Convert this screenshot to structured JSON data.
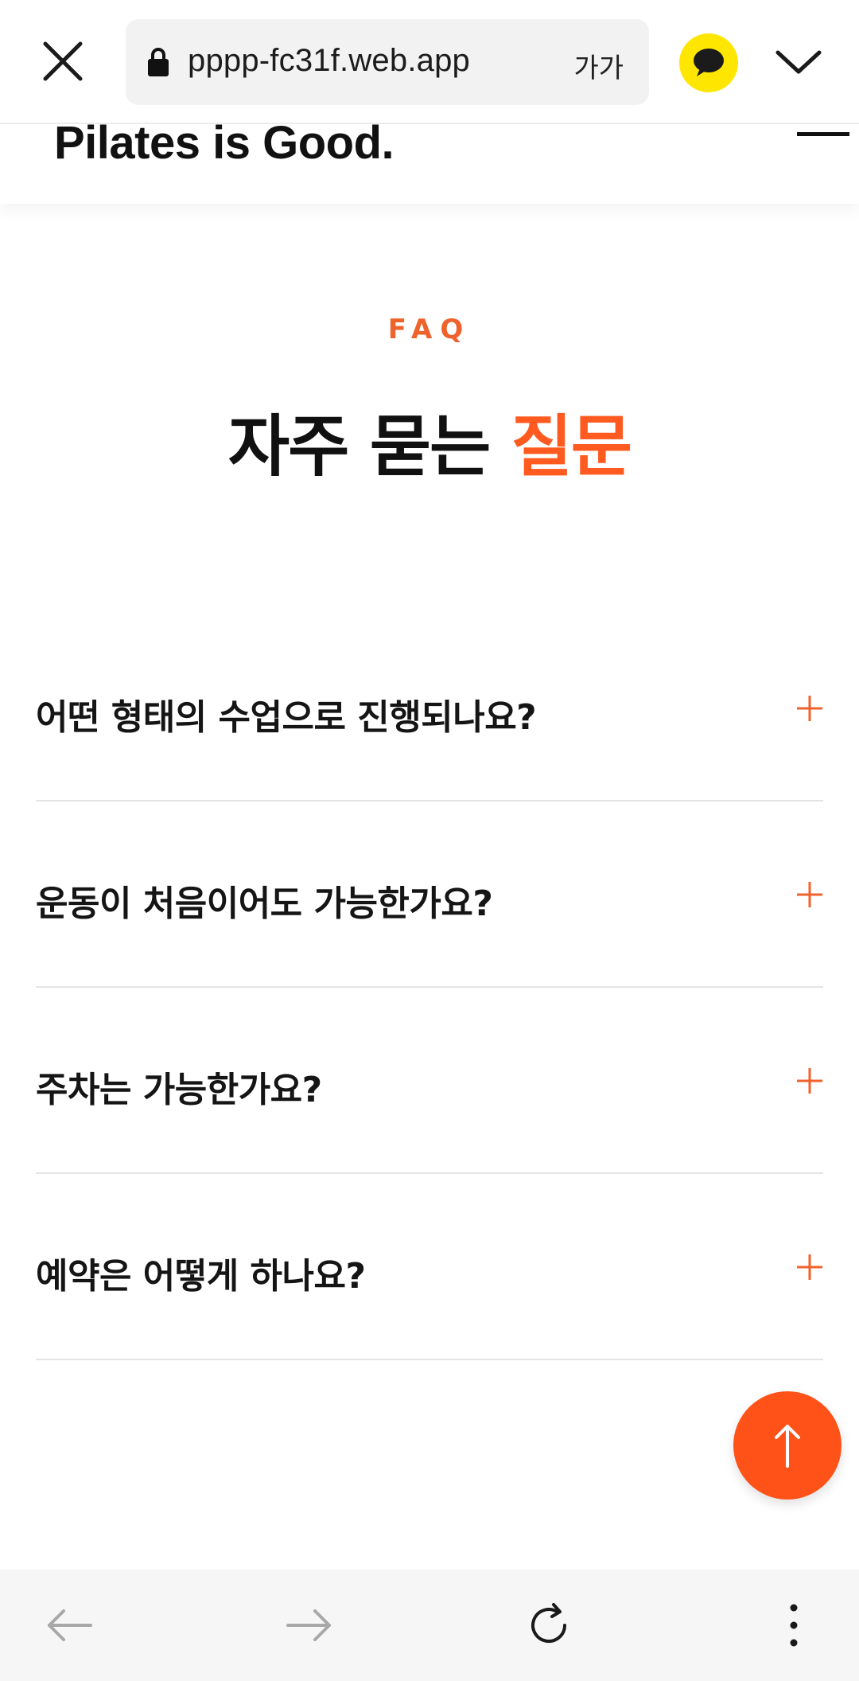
{
  "browser": {
    "url": "pppp-fc31f.web.app",
    "font_size_label": "가가"
  },
  "site": {
    "logo_text": "Pilates is Good."
  },
  "faq": {
    "eyebrow": "FAQ",
    "title_main": "자주 묻는 ",
    "title_accent": "질문",
    "questions": [
      "어떤 형태의 수업으로 진행되나요?",
      "운동이 처음이어도 가능한가요?",
      "주차는 가능한가요?",
      "예약은 어떻게 하나요?"
    ]
  },
  "icons": {
    "close": "close-icon",
    "lock": "lock-icon",
    "kakao": "kakaotalk-icon",
    "chevron": "chevron-down-icon",
    "menu": "menu-icon",
    "plus": "plus-icon",
    "arrow_up": "arrow-up-icon",
    "back": "back-arrow-icon",
    "forward": "forward-arrow-icon",
    "reload": "reload-icon",
    "more": "more-vertical-icon"
  },
  "colors": {
    "accent": "#ff5a1f",
    "kakao_yellow": "#ffe600",
    "text": "#151515",
    "divider": "#e4e4e4"
  }
}
